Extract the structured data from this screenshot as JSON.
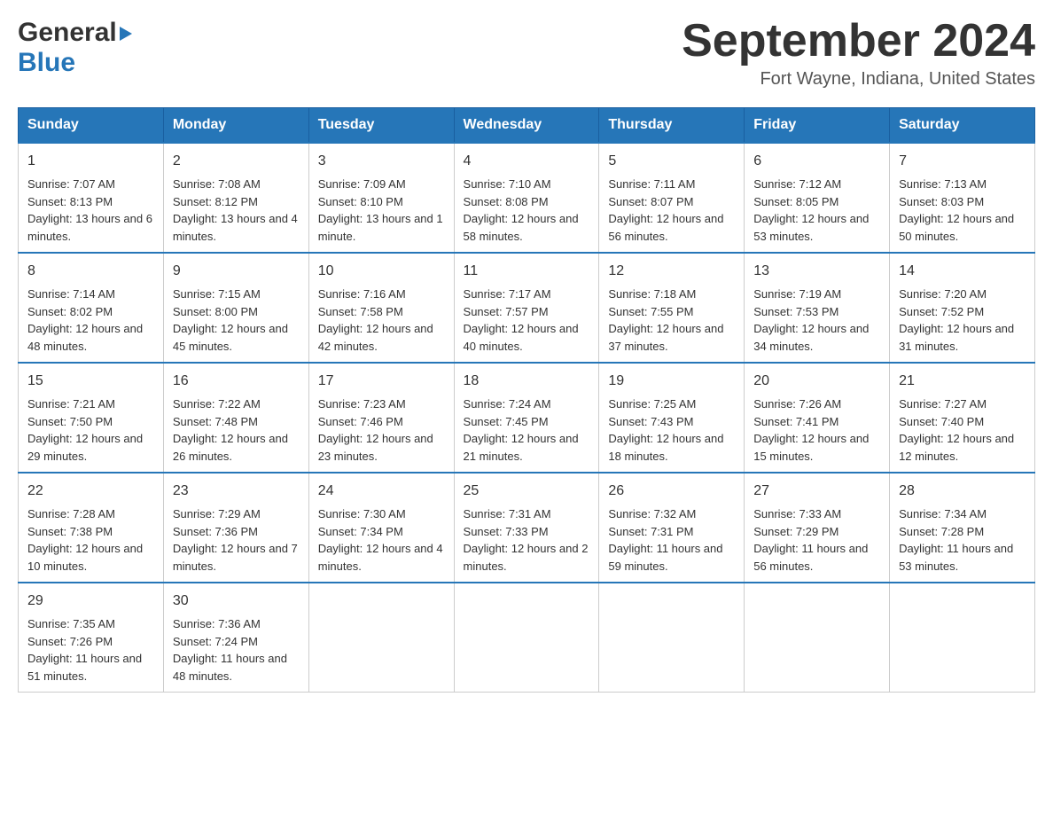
{
  "header": {
    "logo_general": "General",
    "logo_blue": "Blue",
    "month_title": "September 2024",
    "location": "Fort Wayne, Indiana, United States"
  },
  "days_of_week": [
    "Sunday",
    "Monday",
    "Tuesday",
    "Wednesday",
    "Thursday",
    "Friday",
    "Saturday"
  ],
  "weeks": [
    [
      {
        "day": "1",
        "sunrise": "7:07 AM",
        "sunset": "8:13 PM",
        "daylight": "13 hours and 6 minutes."
      },
      {
        "day": "2",
        "sunrise": "7:08 AM",
        "sunset": "8:12 PM",
        "daylight": "13 hours and 4 minutes."
      },
      {
        "day": "3",
        "sunrise": "7:09 AM",
        "sunset": "8:10 PM",
        "daylight": "13 hours and 1 minute."
      },
      {
        "day": "4",
        "sunrise": "7:10 AM",
        "sunset": "8:08 PM",
        "daylight": "12 hours and 58 minutes."
      },
      {
        "day": "5",
        "sunrise": "7:11 AM",
        "sunset": "8:07 PM",
        "daylight": "12 hours and 56 minutes."
      },
      {
        "day": "6",
        "sunrise": "7:12 AM",
        "sunset": "8:05 PM",
        "daylight": "12 hours and 53 minutes."
      },
      {
        "day": "7",
        "sunrise": "7:13 AM",
        "sunset": "8:03 PM",
        "daylight": "12 hours and 50 minutes."
      }
    ],
    [
      {
        "day": "8",
        "sunrise": "7:14 AM",
        "sunset": "8:02 PM",
        "daylight": "12 hours and 48 minutes."
      },
      {
        "day": "9",
        "sunrise": "7:15 AM",
        "sunset": "8:00 PM",
        "daylight": "12 hours and 45 minutes."
      },
      {
        "day": "10",
        "sunrise": "7:16 AM",
        "sunset": "7:58 PM",
        "daylight": "12 hours and 42 minutes."
      },
      {
        "day": "11",
        "sunrise": "7:17 AM",
        "sunset": "7:57 PM",
        "daylight": "12 hours and 40 minutes."
      },
      {
        "day": "12",
        "sunrise": "7:18 AM",
        "sunset": "7:55 PM",
        "daylight": "12 hours and 37 minutes."
      },
      {
        "day": "13",
        "sunrise": "7:19 AM",
        "sunset": "7:53 PM",
        "daylight": "12 hours and 34 minutes."
      },
      {
        "day": "14",
        "sunrise": "7:20 AM",
        "sunset": "7:52 PM",
        "daylight": "12 hours and 31 minutes."
      }
    ],
    [
      {
        "day": "15",
        "sunrise": "7:21 AM",
        "sunset": "7:50 PM",
        "daylight": "12 hours and 29 minutes."
      },
      {
        "day": "16",
        "sunrise": "7:22 AM",
        "sunset": "7:48 PM",
        "daylight": "12 hours and 26 minutes."
      },
      {
        "day": "17",
        "sunrise": "7:23 AM",
        "sunset": "7:46 PM",
        "daylight": "12 hours and 23 minutes."
      },
      {
        "day": "18",
        "sunrise": "7:24 AM",
        "sunset": "7:45 PM",
        "daylight": "12 hours and 21 minutes."
      },
      {
        "day": "19",
        "sunrise": "7:25 AM",
        "sunset": "7:43 PM",
        "daylight": "12 hours and 18 minutes."
      },
      {
        "day": "20",
        "sunrise": "7:26 AM",
        "sunset": "7:41 PM",
        "daylight": "12 hours and 15 minutes."
      },
      {
        "day": "21",
        "sunrise": "7:27 AM",
        "sunset": "7:40 PM",
        "daylight": "12 hours and 12 minutes."
      }
    ],
    [
      {
        "day": "22",
        "sunrise": "7:28 AM",
        "sunset": "7:38 PM",
        "daylight": "12 hours and 10 minutes."
      },
      {
        "day": "23",
        "sunrise": "7:29 AM",
        "sunset": "7:36 PM",
        "daylight": "12 hours and 7 minutes."
      },
      {
        "day": "24",
        "sunrise": "7:30 AM",
        "sunset": "7:34 PM",
        "daylight": "12 hours and 4 minutes."
      },
      {
        "day": "25",
        "sunrise": "7:31 AM",
        "sunset": "7:33 PM",
        "daylight": "12 hours and 2 minutes."
      },
      {
        "day": "26",
        "sunrise": "7:32 AM",
        "sunset": "7:31 PM",
        "daylight": "11 hours and 59 minutes."
      },
      {
        "day": "27",
        "sunrise": "7:33 AM",
        "sunset": "7:29 PM",
        "daylight": "11 hours and 56 minutes."
      },
      {
        "day": "28",
        "sunrise": "7:34 AM",
        "sunset": "7:28 PM",
        "daylight": "11 hours and 53 minutes."
      }
    ],
    [
      {
        "day": "29",
        "sunrise": "7:35 AM",
        "sunset": "7:26 PM",
        "daylight": "11 hours and 51 minutes."
      },
      {
        "day": "30",
        "sunrise": "7:36 AM",
        "sunset": "7:24 PM",
        "daylight": "11 hours and 48 minutes."
      },
      null,
      null,
      null,
      null,
      null
    ]
  ],
  "labels": {
    "sunrise": "Sunrise:",
    "sunset": "Sunset:",
    "daylight": "Daylight:"
  }
}
